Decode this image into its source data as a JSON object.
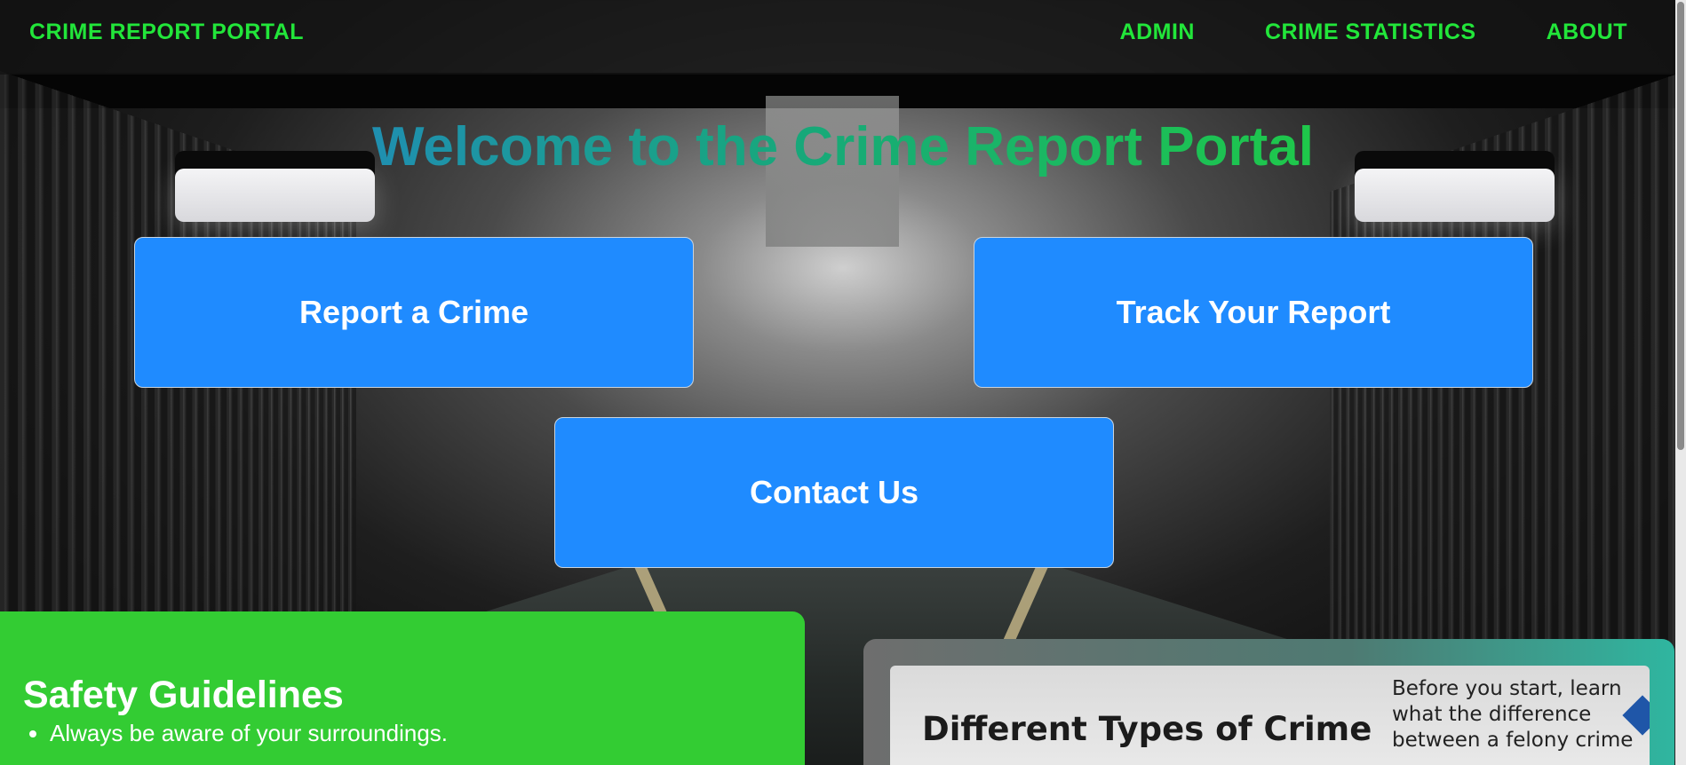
{
  "navbar": {
    "brand": "CRIME REPORT PORTAL",
    "links": [
      "ADMIN",
      "CRIME STATISTICS",
      "ABOUT"
    ],
    "link_color": "#22e63a"
  },
  "hero": {
    "title": "Welcome to the Crime Report Portal"
  },
  "actions": {
    "report": "Report a Crime",
    "track": "Track Your Report",
    "contact": "Contact Us",
    "button_color": "#1f8bff"
  },
  "safety": {
    "heading": "Safety Guidelines",
    "items": [
      "Always be aware of your surroundings."
    ],
    "panel_color": "#33cc33"
  },
  "infographic": {
    "title": "Different Types of Crime",
    "text": "Before you start, learn what the difference between a felony crime"
  }
}
